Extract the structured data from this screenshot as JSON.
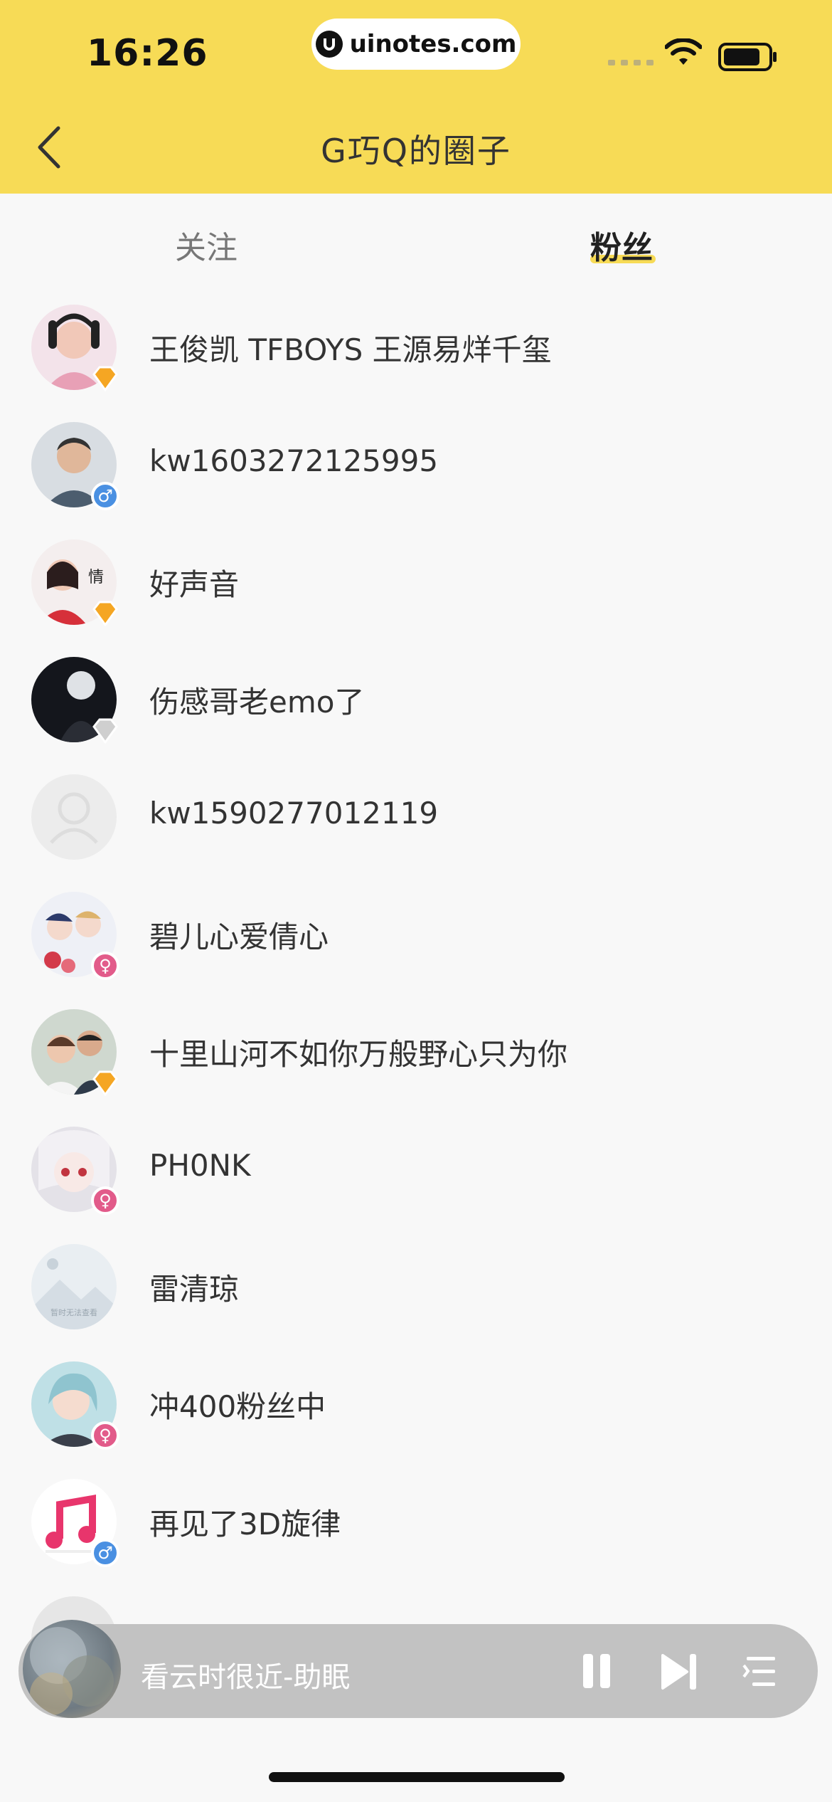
{
  "status_bar": {
    "time": "16:26",
    "url": "uinotes.com"
  },
  "header": {
    "title": "G巧Q的圈子"
  },
  "tabs": {
    "follow": "关注",
    "fans": "粉丝",
    "active": "粉丝"
  },
  "fans": [
    {
      "name": "王俊凯 TFBOYS 王源易烊千玺",
      "badge": "gold"
    },
    {
      "name": "kw1603272125995",
      "badge": "male"
    },
    {
      "name": "好声音",
      "badge": "gold"
    },
    {
      "name": "伤感哥老emo了",
      "badge": "silver"
    },
    {
      "name": "kw1590277012119",
      "badge": "none"
    },
    {
      "name": "碧儿心爱倩心",
      "badge": "female"
    },
    {
      "name": "十里山河不如你万般野心只为你",
      "badge": "gold"
    },
    {
      "name": "PH0NK",
      "badge": "female"
    },
    {
      "name": "雷清琼",
      "badge": "none"
    },
    {
      "name": "冲400粉丝中",
      "badge": "female"
    },
    {
      "name": "再见了3D旋律",
      "badge": "male"
    }
  ],
  "placeholder_avatar_text": "暂时无法查看",
  "player": {
    "title": "看云时很近-助眠"
  },
  "colors": {
    "header_bg": "#f7db56",
    "male": "#4a90e2",
    "female": "#e25b8a",
    "gold": "#f5a623"
  }
}
